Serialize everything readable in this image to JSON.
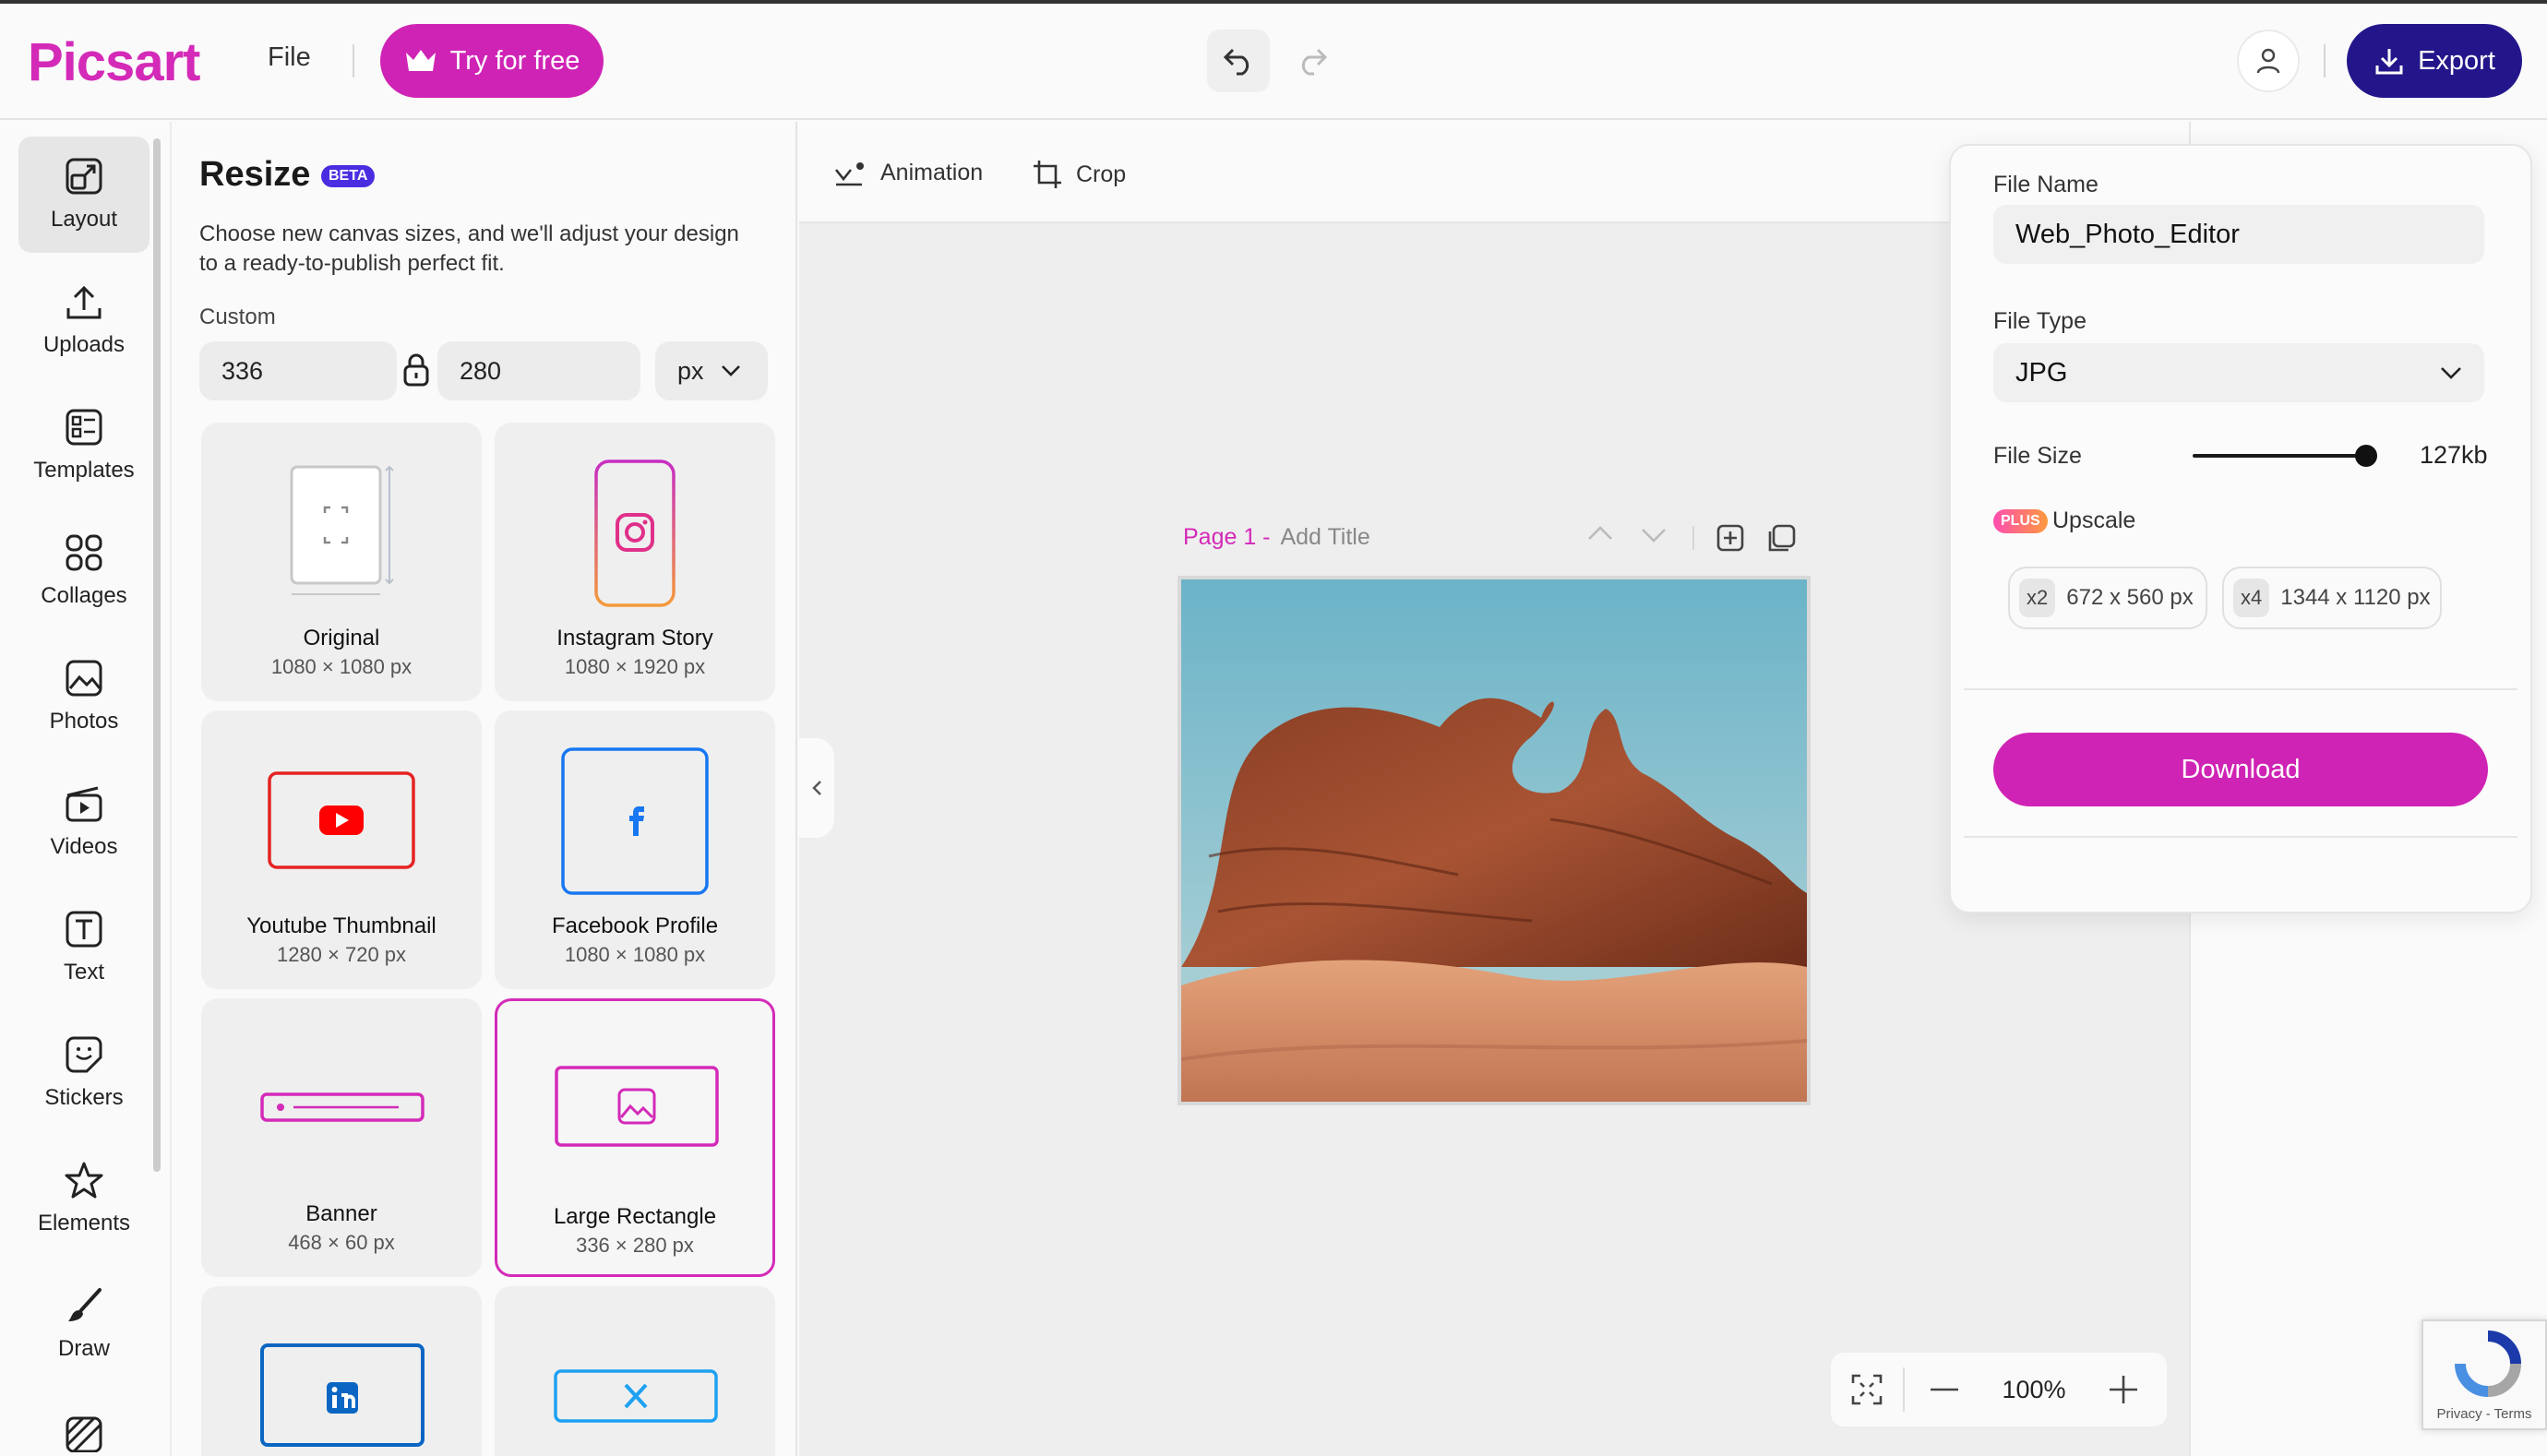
{
  "header": {
    "logo": "Picsart",
    "file_menu": "File",
    "try_label": "Try for free",
    "export_label": "Export"
  },
  "rail": {
    "items": [
      {
        "label": "Layout",
        "icon": "layout-icon"
      },
      {
        "label": "Uploads",
        "icon": "upload-icon"
      },
      {
        "label": "Templates",
        "icon": "templates-icon"
      },
      {
        "label": "Collages",
        "icon": "collages-icon"
      },
      {
        "label": "Photos",
        "icon": "photo-icon"
      },
      {
        "label": "Videos",
        "icon": "video-icon"
      },
      {
        "label": "Text",
        "icon": "text-icon"
      },
      {
        "label": "Stickers",
        "icon": "sticker-icon"
      },
      {
        "label": "Elements",
        "icon": "star-icon"
      },
      {
        "label": "Draw",
        "icon": "brush-icon"
      }
    ]
  },
  "resize": {
    "title": "Resize",
    "badge": "BETA",
    "description": "Choose new canvas sizes, and we'll adjust your design to a ready-to-publish perfect fit.",
    "custom_label": "Custom",
    "width": "336",
    "height": "280",
    "unit": "px",
    "presets": [
      {
        "label": "Original",
        "size": "1080 × 1080 px"
      },
      {
        "label": "Instagram Story",
        "size": "1080 × 1920 px"
      },
      {
        "label": "Youtube Thumbnail",
        "size": "1280 × 720 px"
      },
      {
        "label": "Facebook Profile",
        "size": "1080 × 1080 px"
      },
      {
        "label": "Banner",
        "size": "468 × 60 px"
      },
      {
        "label": "Large Rectangle",
        "size": "336 × 280 px"
      }
    ]
  },
  "toolbar": {
    "animation": "Animation",
    "crop": "Crop"
  },
  "canvas": {
    "page_label": "Page 1 -",
    "add_title": "Add Title",
    "zoom": "100%"
  },
  "export_panel": {
    "file_name_label": "File Name",
    "file_name": "Web_Photo_Editor",
    "file_type_label": "File Type",
    "file_type": "JPG",
    "file_size_label": "File Size",
    "file_size": "127kb",
    "file_size_level": 1.0,
    "plus_badge": "PLUS",
    "upscale_label": "Upscale",
    "upscale_options": [
      {
        "mult": "x2",
        "size": "672 x 560 px"
      },
      {
        "mult": "x4",
        "size": "1344 x 1120 px"
      }
    ],
    "download_label": "Download"
  },
  "recaptcha": {
    "links": "Privacy - Terms"
  },
  "colors": {
    "brand": "#cf23b5",
    "export": "#23168a",
    "beta": "#4a2de0"
  }
}
